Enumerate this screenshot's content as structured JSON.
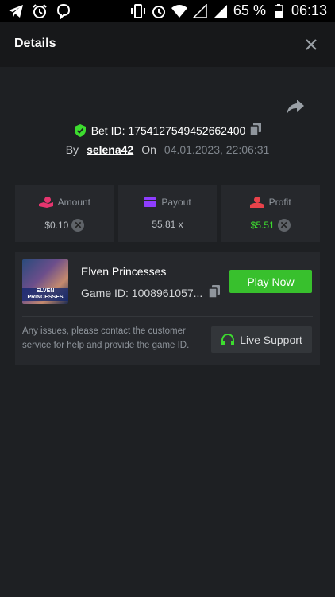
{
  "statusbar": {
    "battery_label": "65 %",
    "time": "06:13"
  },
  "header": {
    "title": "Details"
  },
  "bet": {
    "bet_id_label": "Bet ID: 1754127549452662400",
    "by_label": "By",
    "username": "selena42",
    "on_label": "On",
    "date": "04.01.2023, 22:06:31"
  },
  "stats": {
    "amount": {
      "label": "Amount",
      "value": "$0.10"
    },
    "payout": {
      "label": "Payout",
      "value": "55.81 x"
    },
    "profit": {
      "label": "Profit",
      "value": "$5.51"
    }
  },
  "game": {
    "name": "Elven Princesses",
    "game_id": "Game ID: 1008961057...",
    "thumb_label": "ELVEN PRINCESSES",
    "play_label": "Play Now",
    "issues_text": "Any issues, please contact the customer service for help and provide the game ID.",
    "support_label": "Live Support"
  },
  "colors": {
    "background": "#1e2023",
    "panel": "#26282c",
    "play_button": "#38c02d",
    "profit": "#3ddc2f",
    "amount_icon": "#e6356f",
    "payout_icon": "#8e3dff",
    "profit_icon": "#e8424a",
    "shield_icon": "#3ddc2f"
  }
}
